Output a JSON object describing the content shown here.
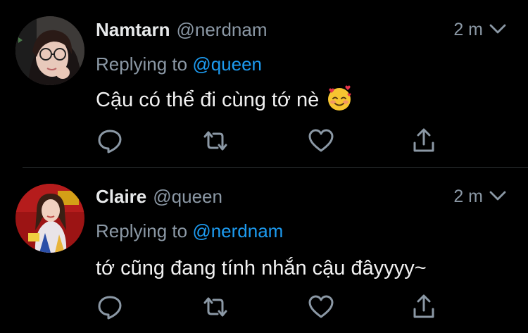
{
  "tweets": [
    {
      "display_name": "Namtarn",
      "handle": "@nerdnam",
      "time": "2 m",
      "reply_prefix": "Replying to",
      "reply_to": "@queen",
      "text": "Cậu có thể đi cùng tớ nè",
      "emoji": "smiling-face-with-hearts"
    },
    {
      "display_name": "Claire",
      "handle": "@queen",
      "time": "2 m",
      "reply_prefix": "Replying to",
      "reply_to": "@nerdnam",
      "text": "tớ cũng đang tính nhắn cậu đâyyyy~"
    }
  ],
  "colors": {
    "background": "#000000",
    "primary_text": "#e7e9ea",
    "secondary_text": "#8b98a5",
    "link": "#1d9bf0",
    "divider": "#2f3336"
  },
  "icons": [
    "reply-icon",
    "retweet-icon",
    "like-icon",
    "share-icon",
    "chevron-down-icon"
  ]
}
